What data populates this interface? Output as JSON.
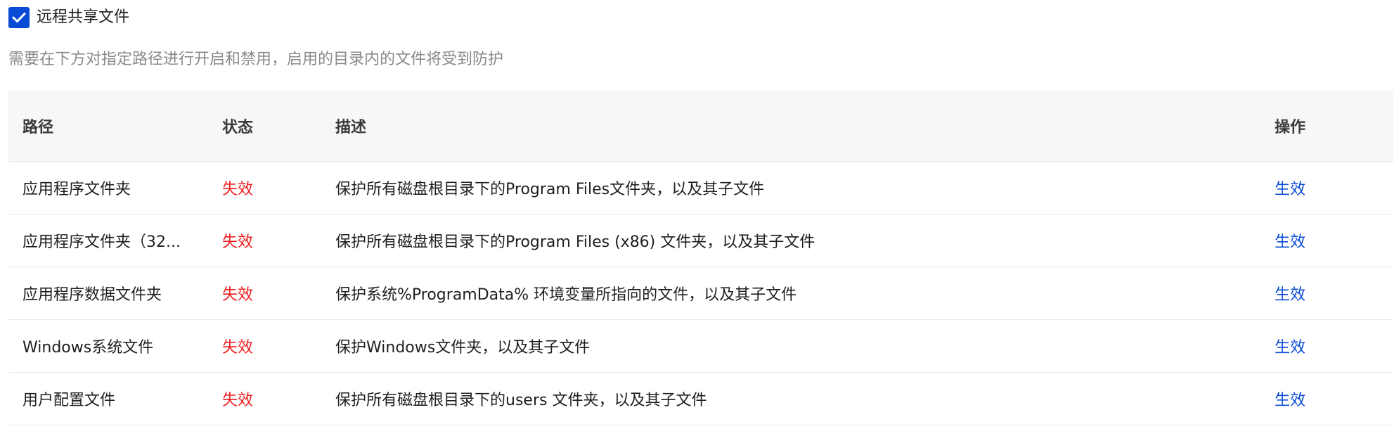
{
  "remote_share": {
    "label": "远程共享文件",
    "checked": true
  },
  "hint": "需要在下方对指定路径进行开启和禁用，启用的目录内的文件将受到防护",
  "table": {
    "headers": {
      "path": "路径",
      "status": "状态",
      "desc": "描述",
      "op": "操作"
    },
    "rows": [
      {
        "path": "应用程序文件夹",
        "status": "失效",
        "desc": "保护所有磁盘根目录下的Program Files文件夹，以及其子文件",
        "op": "生效"
      },
      {
        "path": "应用程序文件夹（32...",
        "status": "失效",
        "desc": "保护所有磁盘根目录下的Program Files (x86) 文件夹，以及其子文件",
        "op": "生效"
      },
      {
        "path": "应用程序数据文件夹",
        "status": "失效",
        "desc": "保护系统%ProgramData% 环境变量所指向的文件，以及其子文件",
        "op": "生效"
      },
      {
        "path": "Windows系统文件",
        "status": "失效",
        "desc": "保护Windows文件夹，以及其子文件",
        "op": "生效"
      },
      {
        "path": "用户配置文件",
        "status": "失效",
        "desc": "保护所有磁盘根目录下的users 文件夹，以及其子文件",
        "op": "生效"
      }
    ]
  },
  "colors": {
    "accent": "#0a4bd6",
    "invalid": "#f01e1e",
    "hint": "#8a8a8a",
    "header_bg": "#f7f7f7"
  }
}
